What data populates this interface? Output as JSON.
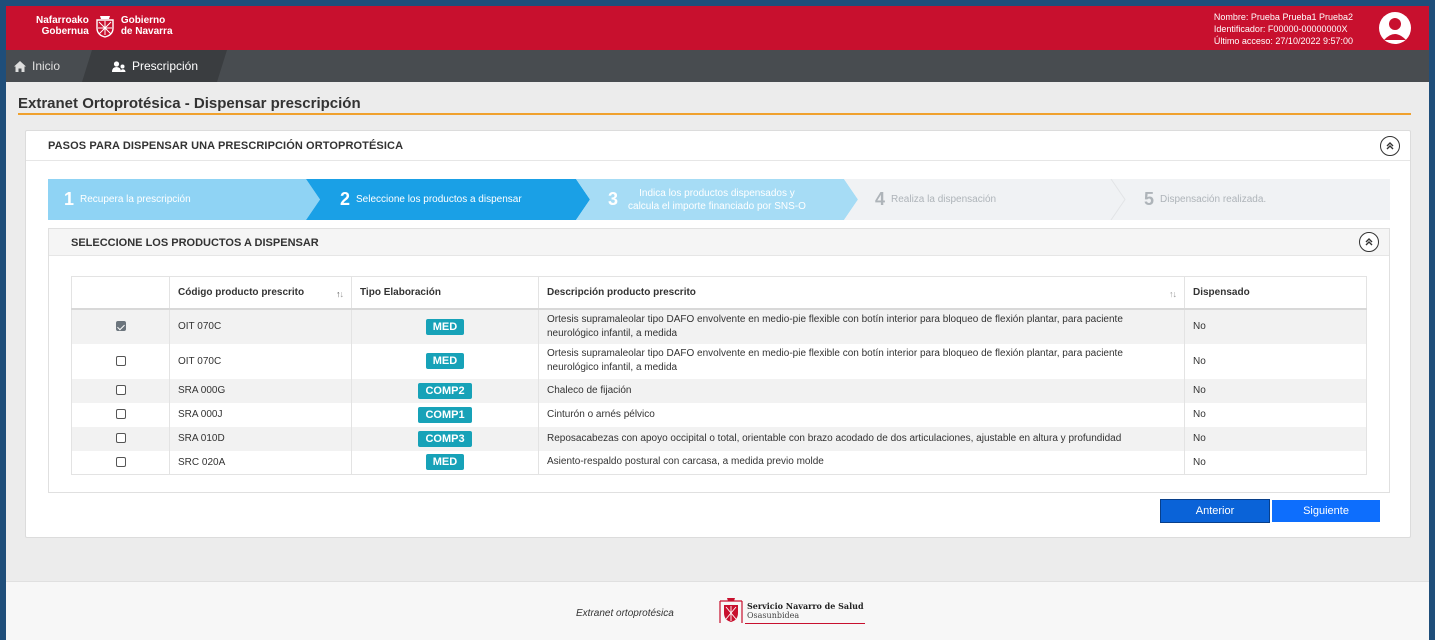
{
  "header": {
    "logo_line1_left": "Nafarroako",
    "logo_line2_left": "Gobernua",
    "logo_line1_right": "Gobierno",
    "logo_line2_right": "de Navarra",
    "user_name": "Nombre: Prueba Prueba1 Prueba2",
    "user_id": "Identificador: F00000-00000000X",
    "last_access": "Último acceso: 27/10/2022 9:57:00",
    "bg_color": "#c8102e"
  },
  "nav": {
    "home_label": "Inicio",
    "active_tab_label": "Prescripción"
  },
  "page": {
    "title": "Extranet Ortoprotésica - Dispensar prescripción"
  },
  "steps_panel": {
    "title": "PASOS PARA DISPENSAR UNA PRESCRIPCIÓN ORTOPROTÉSICA",
    "steps": [
      {
        "num": "1",
        "label": "Recupera la prescripción",
        "state": "done"
      },
      {
        "num": "2",
        "label": "Seleccione los productos a dispensar",
        "state": "active"
      },
      {
        "num": "3",
        "label": "Indica los productos dispensados y calcula el importe financiado por SNS-O",
        "label_line1": "Indica los productos dispensados y",
        "label_line2": "calcula el importe financiado por SNS-O",
        "state": "pending-next"
      },
      {
        "num": "4",
        "label": "Realiza la dispensación",
        "state": "pending"
      },
      {
        "num": "5",
        "label": "Dispensación realizada.",
        "state": "pending"
      }
    ]
  },
  "products_panel": {
    "title": "SELECCIONE LOS PRODUCTOS A DISPENSAR",
    "columns": [
      "",
      "Código producto prescrito",
      "Tipo Elaboración",
      "Descripción producto prescrito",
      "Dispensado"
    ],
    "rows": [
      {
        "checked": true,
        "code": "OIT 070C",
        "type": "MED",
        "desc_line1": "Ortesis supramaleolar tipo DAFO envolvente en medio-pie flexible con botín interior para bloqueo de flexión plantar, para paciente",
        "desc_line2": "neurológico infantil, a medida",
        "dispensed": "No"
      },
      {
        "checked": false,
        "code": "OIT 070C",
        "type": "MED",
        "desc_line1": "Ortesis supramaleolar tipo DAFO envolvente en medio-pie flexible con botín interior para bloqueo de flexión plantar, para paciente",
        "desc_line2": "neurológico infantil, a medida",
        "dispensed": "No"
      },
      {
        "checked": false,
        "code": "SRA 000G",
        "type": "COMP2",
        "desc_line1": "Chaleco de fijación",
        "desc_line2": "",
        "dispensed": "No"
      },
      {
        "checked": false,
        "code": "SRA 000J",
        "type": "COMP1",
        "desc_line1": "Cinturón o arnés pélvico",
        "desc_line2": "",
        "dispensed": "No"
      },
      {
        "checked": false,
        "code": "SRA 010D",
        "type": "COMP3",
        "desc_line1": "Reposacabezas con apoyo occipital o total, orientable con brazo acodado de dos articulaciones, ajustable en altura y profundidad",
        "desc_line2": "",
        "dispensed": "No"
      },
      {
        "checked": false,
        "code": "SRC 020A",
        "type": "MED",
        "desc_line1": "Asiento-respaldo postural con carcasa, a medida previo molde",
        "desc_line2": "",
        "dispensed": "No"
      }
    ]
  },
  "buttons": {
    "prev": "Anterior",
    "next": "Siguiente"
  },
  "footer": {
    "text": "Extranet ortoprotésica",
    "logo_line1": "Servicio Navarro de Salud",
    "logo_line2": "Osasunbidea"
  },
  "colors": {
    "step_done": "#8fd3f4",
    "step_active": "#1aa0e6",
    "step_pending": "#f0f2f4",
    "badge": "#17a2b8",
    "button": "#0d6efd",
    "title_rule": "#f0a12e"
  }
}
